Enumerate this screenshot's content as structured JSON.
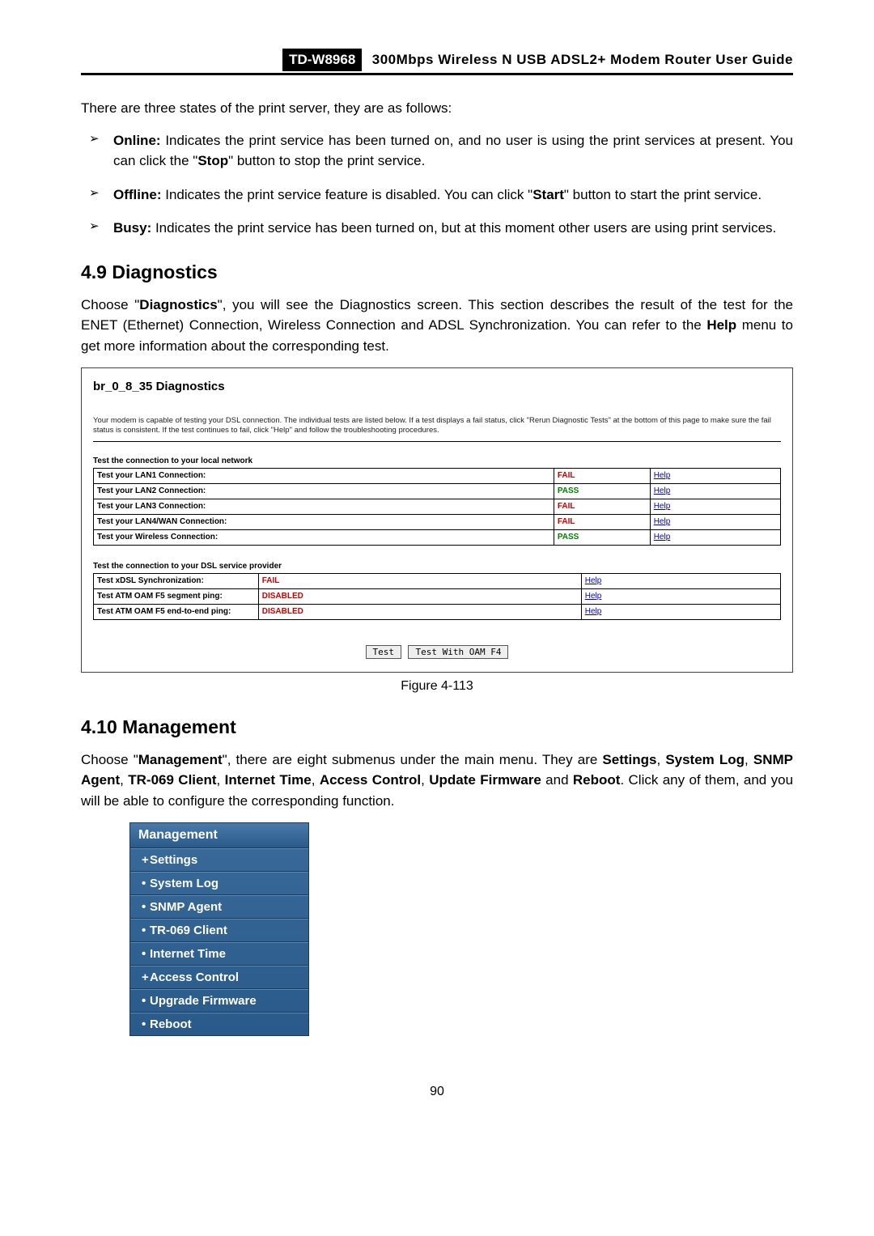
{
  "header": {
    "model": "TD-W8968",
    "title": "300Mbps Wireless N USB ADSL2+ Modem Router User Guide"
  },
  "intro_text": "There are three states of the print server, they are as follows:",
  "states": [
    {
      "label": "Online:",
      "desc_a": " Indicates the print service has been turned on, and no user is using the print services at present. You can click the \"",
      "stop": "Stop",
      "desc_b": "\" button to stop the print service."
    },
    {
      "label": "Offline:",
      "desc_a": " Indicates the print service feature is disabled. You can click \"",
      "start": "Start",
      "desc_b": "\" button to start the print service."
    },
    {
      "label": "Busy:",
      "desc_a": " Indicates the print service has been turned on, but at this moment other users are using print services."
    }
  ],
  "sec49": {
    "heading": "4.9  Diagnostics",
    "p_a": "Choose \"",
    "p_b": "Diagnostics",
    "p_c": "\", you will see the Diagnostics screen. This section describes the result of the test for the ENET (Ethernet) Connection, Wireless Connection and ADSL Synchronization. You can refer to the ",
    "p_d": "Help",
    "p_e": " menu to get more information about the corresponding test."
  },
  "diag": {
    "title": "br_0_8_35 Diagnostics",
    "desc": "Your modem is capable of testing your DSL connection. The individual tests are listed below. If a test displays a fail status, click \"Rerun Diagnostic Tests\" at the bottom of this page to make sure the fail status is consistent. If the test continues to fail, click \"Help\" and follow the troubleshooting procedures.",
    "sub1": "Test the connection to your local network",
    "rows1": [
      {
        "name": "Test your LAN1 Connection:",
        "status": "FAIL",
        "help": "Help"
      },
      {
        "name": "Test your LAN2 Connection:",
        "status": "PASS",
        "help": "Help"
      },
      {
        "name": "Test your LAN3 Connection:",
        "status": "FAIL",
        "help": "Help"
      },
      {
        "name": "Test your LAN4/WAN Connection:",
        "status": "FAIL",
        "help": "Help"
      },
      {
        "name": "Test your Wireless Connection:",
        "status": "PASS",
        "help": "Help"
      }
    ],
    "sub2": "Test the connection to your DSL service provider",
    "rows2": [
      {
        "name": "Test xDSL Synchronization:",
        "status": "FAIL",
        "help": "Help"
      },
      {
        "name": "Test ATM OAM F5 segment ping:",
        "status": "DISABLED",
        "help": "Help"
      },
      {
        "name": "Test ATM OAM F5 end-to-end ping:",
        "status": "DISABLED",
        "help": "Help"
      }
    ],
    "btn1": "Test",
    "btn2": "Test With OAM F4"
  },
  "figure_caption": "Figure 4-113",
  "sec410": {
    "heading": "4.10  Management",
    "p_a": "Choose \"",
    "p_b": "Management",
    "p_c": "\", there are eight submenus under the main menu. They are ",
    "p_d": "Settings",
    "p_e": ", ",
    "p_f": "System Log",
    "p_g": ", ",
    "p_h": "SNMP Agent",
    "p_i": ", ",
    "p_j": "TR-069 Client",
    "p_k": ", ",
    "p_l": "Internet Time",
    "p_m": ", ",
    "p_n": "Access Control",
    "p_o": ", ",
    "p_p": "Update Firmware",
    "p_q": " and ",
    "p_r": "Reboot",
    "p_s": ". Click any of them, and you will be able to configure the corresponding function."
  },
  "mgmt_menu": {
    "title": "Management",
    "items": [
      {
        "bullet": "+",
        "label": "Settings"
      },
      {
        "bullet": "•",
        "label": "System Log"
      },
      {
        "bullet": "•",
        "label": "SNMP Agent"
      },
      {
        "bullet": "•",
        "label": "TR-069 Client"
      },
      {
        "bullet": "•",
        "label": "Internet Time"
      },
      {
        "bullet": "+",
        "label": "Access Control"
      },
      {
        "bullet": "•",
        "label": "Upgrade Firmware"
      },
      {
        "bullet": "•",
        "label": "Reboot"
      }
    ]
  },
  "page_number": "90"
}
